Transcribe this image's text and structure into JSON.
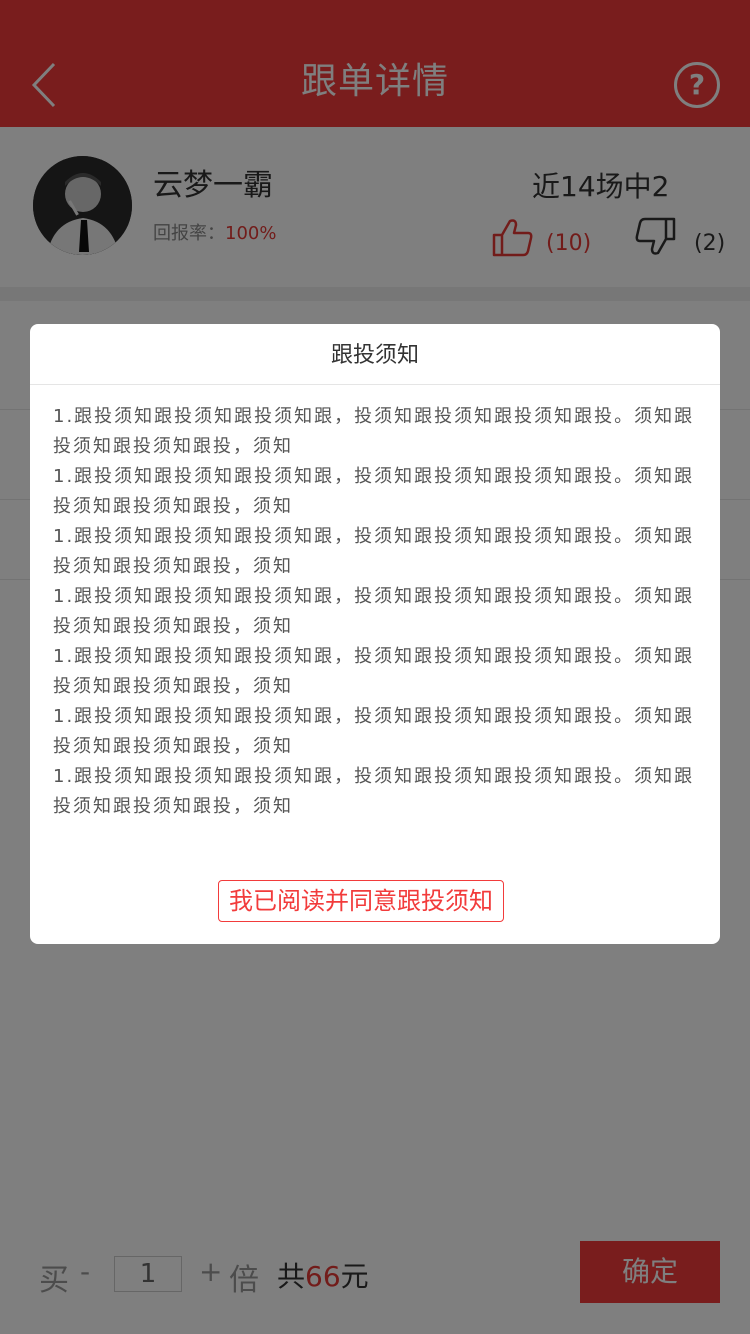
{
  "header": {
    "title": "跟单详情",
    "back_icon": "chevron-left-icon",
    "help_label": "?"
  },
  "profile": {
    "name": "云梦一霸",
    "return_rate_label": "回报率：",
    "return_rate_value": "100%",
    "record": "近14场中2",
    "likes": "(10)",
    "dislikes": "(2)"
  },
  "footer": {
    "buy_label": "买",
    "minus_label": "-",
    "quantity": "1",
    "plus_label": "+",
    "multiplier_label": "倍",
    "total_prefix": "共",
    "total_amount": "66",
    "total_unit": "元",
    "confirm_label": "确定"
  },
  "modal": {
    "title": "跟投须知",
    "paragraphs": [
      "1.跟投须知跟投须知跟投须知跟，投须知跟投须知跟投须知跟投。须知跟投须知跟投须知跟投，须知",
      "1.跟投须知跟投须知跟投须知跟，投须知跟投须知跟投须知跟投。须知跟投须知跟投须知跟投，须知",
      "1.跟投须知跟投须知跟投须知跟，投须知跟投须知跟投须知跟投。须知跟投须知跟投须知跟投，须知",
      "1.跟投须知跟投须知跟投须知跟，投须知跟投须知跟投须知跟投。须知跟投须知跟投须知跟投，须知",
      "1.跟投须知跟投须知跟投须知跟，投须知跟投须知跟投须知跟投。须知跟投须知跟投须知跟投，须知",
      "1.跟投须知跟投须知跟投须知跟，投须知跟投须知跟投须知跟投。须知跟投须知跟投须知跟投，须知",
      "1.跟投须知跟投须知跟投须知跟，投须知跟投须知跟投须知跟投。须知跟投须知跟投须知跟投，须知"
    ],
    "agree_label": "我已阅读并同意跟投须知"
  },
  "colors": {
    "brand": "#f23b3b",
    "accent_text": "#e53935",
    "overlay": "rgba(0,0,0,0.5)"
  }
}
